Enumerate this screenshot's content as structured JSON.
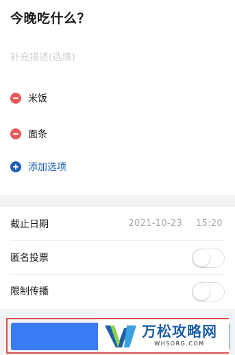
{
  "poll": {
    "title": "今晚吃什么？",
    "description_placeholder": "补充描述(选填)",
    "options": [
      {
        "label": "米饭",
        "icon": "remove-icon"
      },
      {
        "label": "面条",
        "icon": "remove-icon"
      }
    ],
    "add_option_label": "添加选项"
  },
  "settings": {
    "deadline": {
      "label": "截止日期",
      "date": "2021-10-23",
      "time": "15:20"
    },
    "anonymous": {
      "label": "匿名投票",
      "enabled": false
    },
    "limit_spread": {
      "label": "限制传播",
      "enabled": false
    }
  },
  "watermark": {
    "name": "万松攻略网",
    "domain": "WHSORG.COM"
  },
  "colors": {
    "remove": "#e85a5a",
    "add": "#1f5fb8",
    "submit": "#3a7bf6",
    "highlight_frame": "#d9534f"
  }
}
